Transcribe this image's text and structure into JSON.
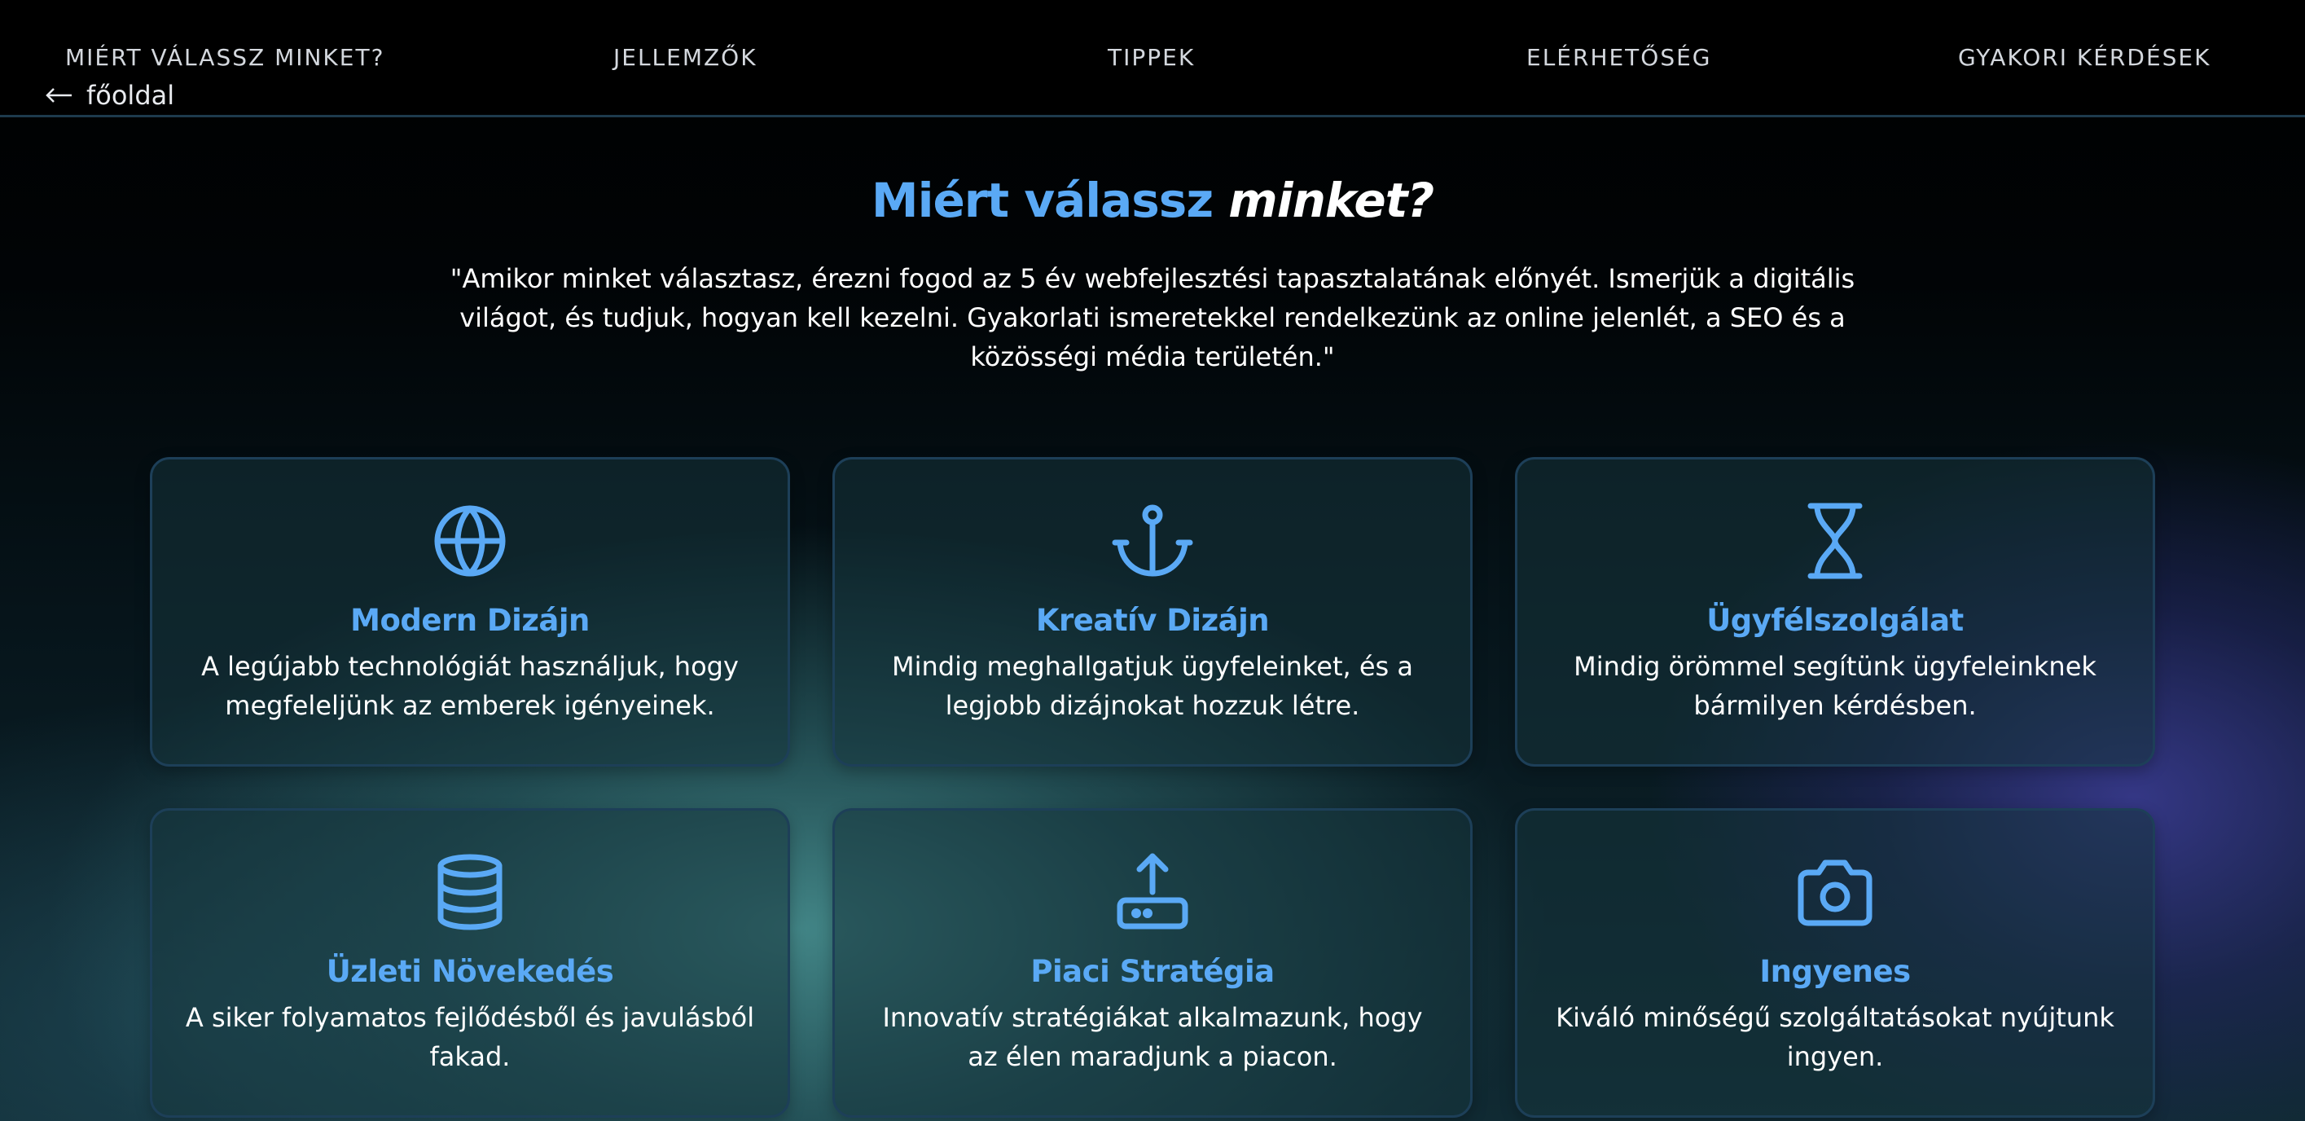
{
  "nav": {
    "links": [
      "MIÉRT VÁLASSZ MINKET?",
      "JELLEMZŐK",
      "TIPPEK",
      "ELÉRHETŐSÉG",
      "GYAKORI KÉRDÉSEK"
    ],
    "back": {
      "label": "főoldal",
      "icon": "arrow-left-icon"
    }
  },
  "hero": {
    "title_part1": "Miért válassz",
    "title_part2": "minket?",
    "text": "\"Amikor minket választasz, érezni fogod az 5 év webfejlesztési tapasztalatának előnyét. Ismerjük a digitális világot, és tudjuk, hogyan kell kezelni. Gyakorlati ismeretekkel rendelkezünk az online jelenlét, a SEO és a közösségi média területén.\""
  },
  "colors": {
    "accent": "#5aa9f5",
    "nav_bg": "#000000",
    "card_border": "#1d3f58",
    "text": "#ffffff"
  },
  "cards": [
    {
      "icon": "globe-icon",
      "title": "Modern Dizájn",
      "text": "A legújabb technológiát használjuk, hogy megfeleljünk az emberek igényeinek."
    },
    {
      "icon": "anchor-icon",
      "title": "Kreatív Dizájn",
      "text": "Mindig meghallgatjuk ügyfeleinket, és a legjobb dizájnokat hozzuk létre."
    },
    {
      "icon": "hourglass-icon",
      "title": "Ügyfélszolgálat",
      "text": "Mindig örömmel segítünk ügyfeleinknek bármilyen kérdésben."
    },
    {
      "icon": "database-icon",
      "title": "Üzleti Növekedés",
      "text": "A siker folyamatos fejlődésből és javulásból fakad."
    },
    {
      "icon": "router-upload-icon",
      "title": "Piaci Stratégia",
      "text": "Innovatív stratégiákat alkalmazunk, hogy az élen maradjunk a piacon."
    },
    {
      "icon": "camera-icon",
      "title": "Ingyenes",
      "text": "Kiváló minőségű szolgáltatásokat nyújtunk ingyen."
    }
  ]
}
